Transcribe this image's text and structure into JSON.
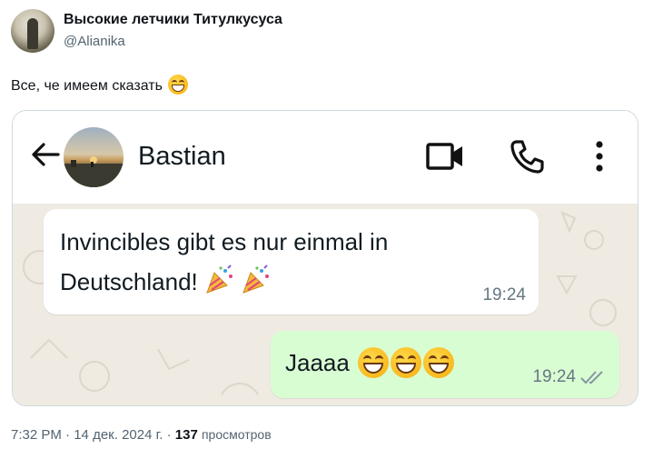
{
  "tweet": {
    "author_name": "Высокие летчики Титулкусуса",
    "author_handle": "@Alianika",
    "text": "Все, че имеем сказать",
    "text_emoji": "grinning-squinting-face",
    "time": "7:32 PM",
    "separator": "·",
    "date": "14 дек. 2024 г.",
    "views_count": "137",
    "views_label": "просмотров"
  },
  "screenshot": {
    "contact_name": "Bastian",
    "icons": [
      "back-arrow-icon",
      "video-call-icon",
      "phone-call-icon",
      "more-options-icon"
    ],
    "messages": [
      {
        "direction": "incoming",
        "text_line1": "Invincibles gibt es nur einmal in",
        "text_line2": "Deutschland!",
        "emoji": [
          "party-popper",
          "party-popper"
        ],
        "time": "19:24"
      },
      {
        "direction": "outgoing",
        "text": "Jaaaa",
        "emoji": [
          "grinning-squinting-face",
          "grinning-squinting-face",
          "grinning-squinting-face"
        ],
        "time": "19:24",
        "status": "read-double-check"
      }
    ],
    "colors": {
      "chat_background": "#efeae2",
      "incoming_bubble": "#ffffff",
      "outgoing_bubble": "#d9fdd3",
      "text": "#111b21",
      "time_text": "#667781"
    }
  }
}
